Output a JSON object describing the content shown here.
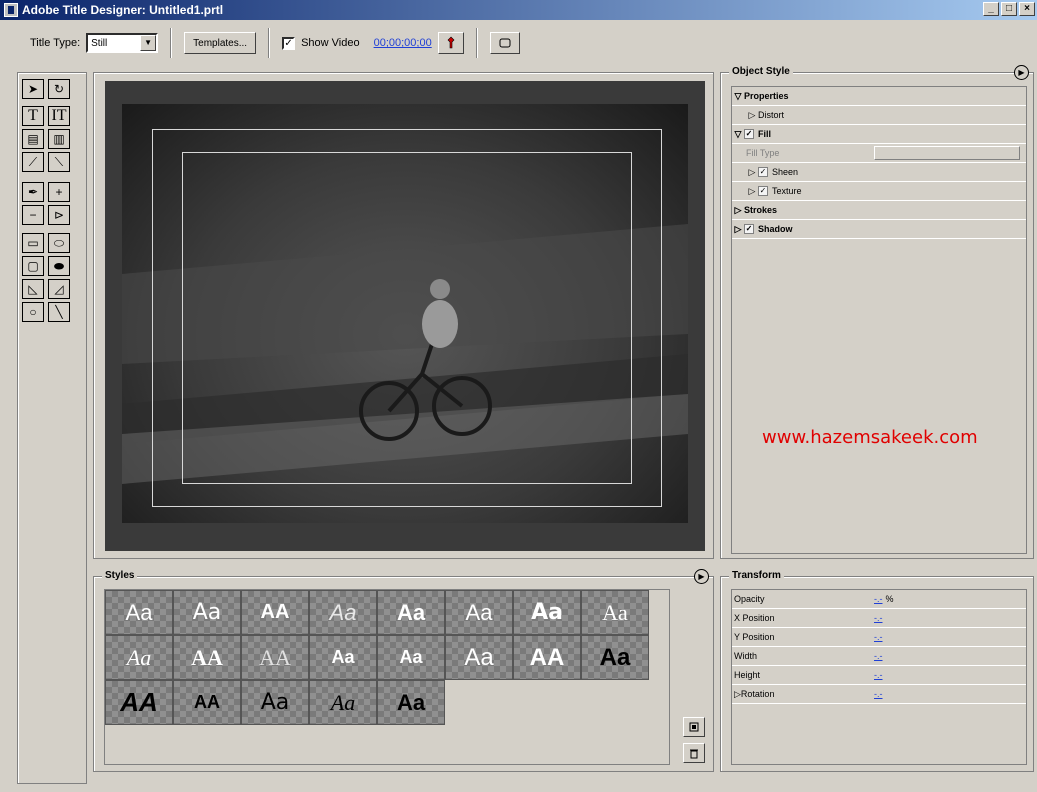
{
  "window": {
    "title": "Adobe Title Designer: Untitled1.prtl",
    "buttons": {
      "minimize": "_",
      "maximize": "□",
      "close": "×"
    }
  },
  "toolbar": {
    "title_type_label": "Title Type:",
    "title_type_value": "Still",
    "templates_label": "Templates...",
    "show_video_label": "Show Video",
    "show_video_checked": "✓",
    "timecode": "00;00;00;00"
  },
  "object_style": {
    "title": "Object Style",
    "rows": [
      {
        "label": "Properties",
        "bold": true
      },
      {
        "label": "Distort"
      },
      {
        "label": "Fill",
        "bold": true
      },
      {
        "label": "Fill Type"
      },
      {
        "label": "Sheen"
      },
      {
        "label": "Texture"
      },
      {
        "label": "Strokes",
        "bold": true
      },
      {
        "label": "Shadow",
        "bold": true
      }
    ],
    "watermark": "www.hazemsakeek.com"
  },
  "styles": {
    "title": "Styles",
    "swatch_text": [
      "Aa",
      "Aa",
      "AA",
      "Aa",
      "Aa",
      "Aa",
      "Aa",
      "Aa",
      "Aa",
      "AA",
      "AA",
      "Aa",
      "Aa",
      "Aa",
      "AA",
      "Aa",
      "AA",
      "AA",
      "Aa",
      "Aa",
      "Aa"
    ]
  },
  "transform": {
    "title": "Transform",
    "rows": [
      {
        "label": "Opacity",
        "value": "-.-",
        "unit": "%"
      },
      {
        "label": "X Position",
        "value": "-.-"
      },
      {
        "label": "Y Position",
        "value": "-.-"
      },
      {
        "label": "Width",
        "value": "-.-"
      },
      {
        "label": "Height",
        "value": "-.-"
      },
      {
        "label": "Rotation",
        "value": "-.-"
      }
    ]
  },
  "colors": {
    "accent": "#0a246a",
    "link": "#1f3fd6",
    "watermark": "#e00000",
    "chrome": "#d4d0c8"
  }
}
